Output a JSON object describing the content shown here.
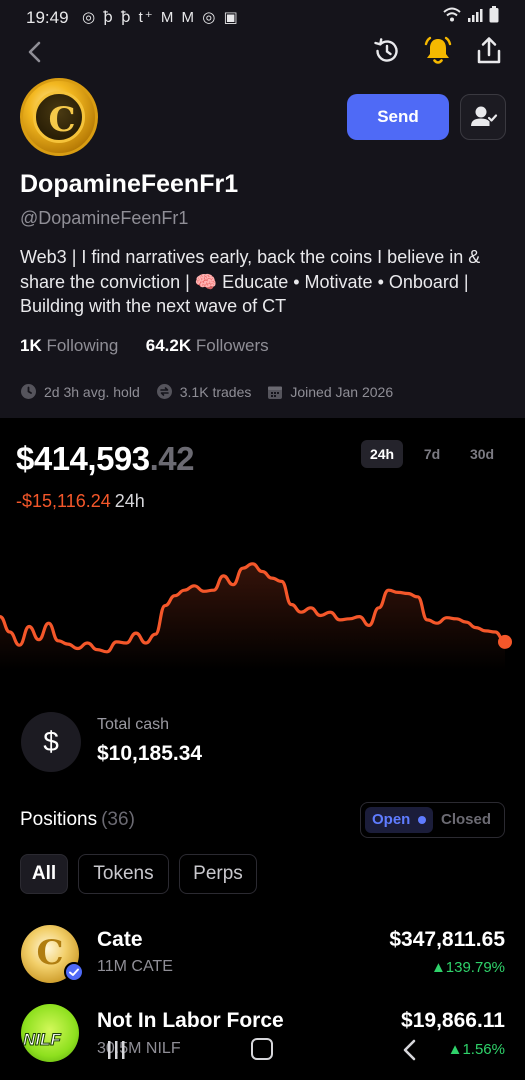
{
  "status_bar": {
    "time": "19:49",
    "notification_icons": "◎ ꝥ ꝥ t⁺ M M ◎ ▣"
  },
  "nav": {
    "icons": [
      "back-icon",
      "history-icon",
      "bell-icon",
      "share-icon"
    ],
    "bell_color": "#f5b800"
  },
  "profile": {
    "display_name": "DopamineFeenFr1",
    "handle": "@DopamineFeenFr1",
    "bio": "Web3 | I find narratives early, back the coins I believe in & share the conviction | 🧠 Educate • Motivate • Onboard | Building with the next wave of CT",
    "following_count": "1K",
    "following_label": "Following",
    "followers_count": "64.2K",
    "followers_label": "Followers",
    "send_label": "Send",
    "stats": {
      "avg_hold": "2d 3h avg. hold",
      "trades": "3.1K trades",
      "joined": "Joined Jan 2026"
    }
  },
  "portfolio": {
    "balance_main": "$414,593",
    "balance_cents": ".42",
    "change_value": "-$15,116.24",
    "change_period": "24h",
    "timeframes": [
      "24h",
      "7d",
      "30d"
    ],
    "active_timeframe": "24h",
    "line_color": "#f4572a"
  },
  "chart_data": {
    "type": "line",
    "series": [
      {
        "values": [
          0.34,
          0.2,
          0.08,
          0.25,
          0.13,
          0.28,
          0.12,
          0.09,
          0.05,
          0.1,
          0.04,
          0.02,
          0.11,
          0.1,
          0.19,
          0.1,
          0.18,
          0.44,
          0.53,
          0.58,
          0.62,
          0.57,
          0.58,
          0.71,
          0.63,
          0.78,
          0.82,
          0.75,
          0.69,
          0.66,
          0.45,
          0.38,
          0.42,
          0.35,
          0.38,
          0.31,
          0.32,
          0.34,
          0.26,
          0.42,
          0.58,
          0.56,
          0.55,
          0.52,
          0.31,
          0.28,
          0.33,
          0.32,
          0.29,
          0.24,
          0.21,
          0.2,
          0.11
        ]
      }
    ]
  },
  "cash": {
    "symbol": "$",
    "label": "Total cash",
    "value": "$10,185.34"
  },
  "positions": {
    "title": "Positions",
    "count": "(36)",
    "open_label": "Open",
    "closed_label": "Closed",
    "filters": [
      "All",
      "Tokens",
      "Perps"
    ],
    "active_filter": "All",
    "items": [
      {
        "name": "Cate",
        "amount": "11M CATE",
        "value": "$347,811.65",
        "change": "▲139.79%",
        "logo": "cate-logo",
        "verified": true
      },
      {
        "name": "Not In Labor Force",
        "amount": "30.5M NILF",
        "value": "$19,866.11",
        "change": "▲1.56%",
        "logo": "nilf-logo",
        "logo_text": "NILF"
      }
    ]
  },
  "system_nav": {
    "icons": [
      "recent-apps-icon",
      "home-icon",
      "system-back-icon"
    ]
  }
}
